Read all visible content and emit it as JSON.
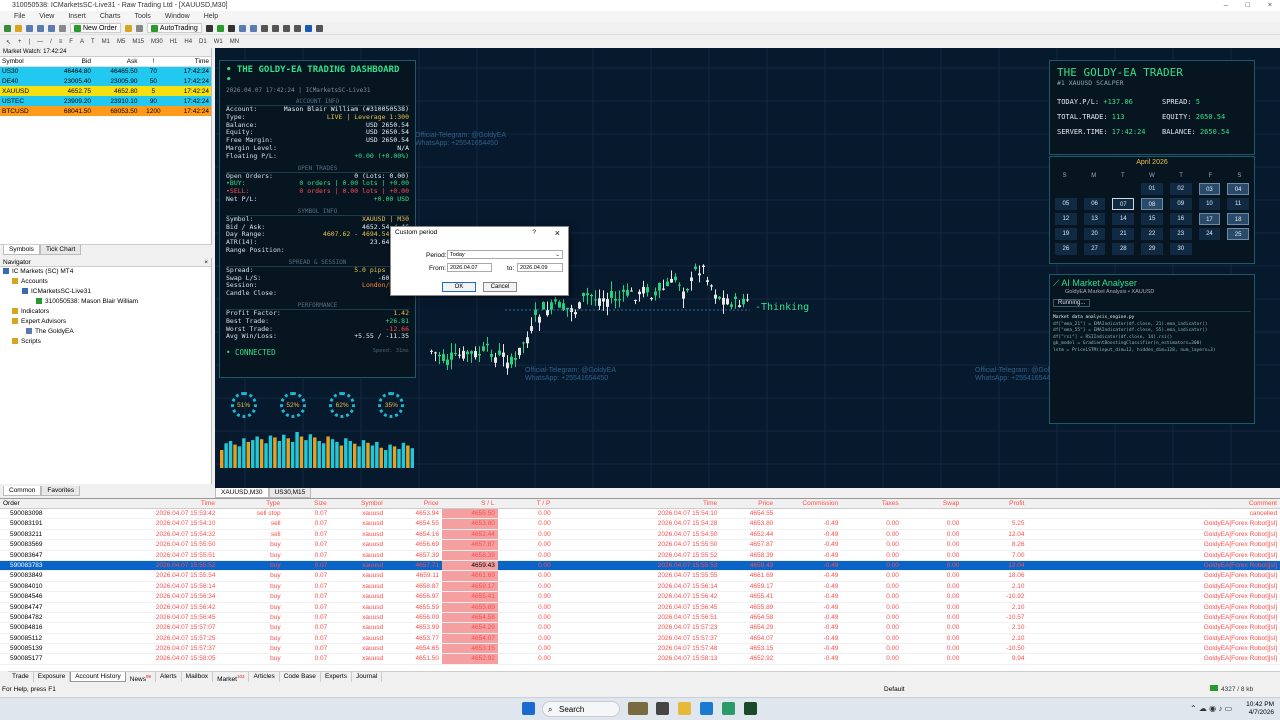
{
  "window": {
    "title": "310050538: ICMarketsSC-Live31 - Raw Trading Ltd - [XAUUSD,M30]",
    "controls": [
      "–",
      "□",
      "×"
    ]
  },
  "menu": [
    "File",
    "View",
    "Insert",
    "Charts",
    "Tools",
    "Window",
    "Help"
  ],
  "toolbar": {
    "new_order": "New Order",
    "autotrading": "AutoTrading"
  },
  "timeframes": [
    "M1",
    "M5",
    "M15",
    "M30",
    "H1",
    "H4",
    "D1",
    "W1",
    "MN"
  ],
  "market_watch": {
    "title": "Market Watch: 17:42:24",
    "columns": [
      "Symbol",
      "Bid",
      "Ask",
      "!",
      "Time"
    ],
    "rows": [
      {
        "symbol": "US30",
        "bid": "46464.80",
        "ask": "46465.50",
        "spread": "70",
        "time": "17:42:24",
        "color": "#21c8f0"
      },
      {
        "symbol": "DE40",
        "bid": "23005.40",
        "ask": "23005.90",
        "spread": "50",
        "time": "17:42:24",
        "color": "#21c8f0"
      },
      {
        "symbol": "XAUUSD",
        "bid": "4652.75",
        "ask": "4652.80",
        "spread": "5",
        "time": "17:42:24",
        "color": "#f7e012"
      },
      {
        "symbol": "USTEC",
        "bid": "23909.20",
        "ask": "23910.10",
        "spread": "90",
        "time": "17:42:24",
        "color": "#21c8f0"
      },
      {
        "symbol": "BTCUSD",
        "bid": "68041.50",
        "ask": "68053.50",
        "spread": "1200",
        "time": "17:42:24",
        "color": "#ff9a1a"
      }
    ],
    "tabs": [
      "Symbols",
      "Tick Chart"
    ]
  },
  "navigator": {
    "title": "Navigator",
    "items": [
      "IC Markets (SC) MT4",
      "Accounts",
      "ICMarketsSC-Live31",
      "310050538: Mason Blair William",
      "Indicators",
      "Expert Advisors",
      "The GoldyEA",
      "Scripts"
    ],
    "tabs": [
      "Common",
      "Favorites"
    ]
  },
  "dashboard": {
    "title": "• THE GOLDY-EA TRADING DASHBOARD •",
    "subtitle": "2026.04.07 17:42:24  |  ICMarketsSC-Live31",
    "sec_account": "ACCOUNT INFO",
    "account": [
      [
        "Account:",
        "Mason Blair William (#310050538)"
      ],
      [
        "Type:",
        "LIVE  |  Leverage 1:300"
      ],
      [
        "Balance:",
        "USD 2650.54"
      ],
      [
        "Equity:",
        "USD 2650.54"
      ],
      [
        "Free Margin:",
        "USD 2650.54"
      ],
      [
        "Margin Level:",
        "N/A"
      ],
      [
        "Floating P/L:",
        "+0.00 (+0.00%)"
      ]
    ],
    "sec_trades": "OPEN TRADES",
    "trades": [
      [
        "Open Orders:",
        "0  (Lots: 0.00)"
      ],
      [
        "•BUY:",
        "0 orders | 0.00 lots | +0.00"
      ],
      [
        "•SELL:",
        "0 orders | 0.00 lots | +0.00"
      ],
      [
        "Net P/L:",
        "+0.00 USD"
      ]
    ],
    "sec_symbol": "SYMBOL INFO",
    "symbol": [
      [
        "Symbol:",
        "XAUUSD  |  M30"
      ],
      [
        "Bid / Ask:",
        "4652.54 / 46"
      ],
      [
        "Day Range:",
        "4607.62 - 4694.54 (869"
      ],
      [
        "ATR(14):",
        "23.64 (236"
      ],
      [
        "Range Position:",
        ""
      ]
    ],
    "sec_spread": "SPREAD & SESSION",
    "spread": [
      [
        "Spread:",
        "5.0 pips (5 po"
      ],
      [
        "Swap L/S:",
        "-60.66 /"
      ],
      [
        "Session:",
        "London/NY Ov"
      ],
      [
        "Candle Close:",
        "17:36"
      ]
    ],
    "sec_perf": "PERFORMANCE",
    "perf": [
      [
        "Profit Factor:",
        "1.42"
      ],
      [
        "Best Trade:",
        "+26.81"
      ],
      [
        "Worst Trade:",
        "-12.66"
      ],
      [
        "Avg Win/Loss:",
        "+5.55 / -11.35"
      ]
    ],
    "status": "• CONNECTED",
    "speed": "Speed: 31ms"
  },
  "gauges": [
    "51%",
    "52%",
    "62%",
    "35%"
  ],
  "volume_bars": [
    40,
    55,
    60,
    52,
    48,
    66,
    58,
    62,
    70,
    64,
    55,
    72,
    68,
    60,
    74,
    66,
    58,
    80,
    70,
    62,
    75,
    68,
    60,
    55,
    70,
    64,
    58,
    50,
    66,
    60,
    54,
    48,
    62,
    56,
    50,
    58,
    45,
    40,
    52,
    48,
    42,
    56,
    50,
    44
  ],
  "trader": {
    "title": "THE GOLDY-EA TRADER",
    "subtitle": "#1 XAUUSD SCALPER",
    "today_label": "TODAY.P/L:",
    "today_value": "+137.06",
    "spread_label": "SPREAD:",
    "spread_value": "5",
    "total_label": "TOTAL.TRADE:",
    "total_value": "113",
    "equity_label": "EQUITY:",
    "equity_value": "2650.54",
    "server_label": "SERVER.TIME:",
    "server_value": "17:42:24",
    "balance_label": "BALANCE:",
    "balance_value": "2650.54"
  },
  "calendar": {
    "month": "April 2026",
    "dow": [
      "S",
      "M",
      "T",
      "W",
      "T",
      "F",
      "S"
    ],
    "days": [
      "",
      "",
      "",
      "01",
      "02",
      "03",
      "04",
      "05",
      "06",
      "07",
      "08",
      "09",
      "10",
      "11",
      "12",
      "13",
      "14",
      "15",
      "16",
      "17",
      "18",
      "19",
      "20",
      "21",
      "22",
      "23",
      "24",
      "25",
      "26",
      "27",
      "28",
      "29",
      "30",
      "",
      ""
    ],
    "highlight": [
      "03",
      "04",
      "08",
      "17",
      "18",
      "25"
    ],
    "today": "07"
  },
  "ai": {
    "title": "AI Market Analyser",
    "subtitle": "GoldyEA Market Analysis • XAUUSD",
    "running": "Running...",
    "code": [
      "Market data analysis_engine.py",
      "df[\"ema_21\"] = EMAIndicator(df.close, 21).ema_indicator()",
      "df[\"ema_55\"] = EMAIndicator(df.close, 55).ema_indicator()",
      "df[\"rsi\"] = RSIIndicator(df.close, 14).rsi()",
      "gb_model = GradientBoostingClassifier(n_estimators=300)",
      "lstm = PriceLSTM(input_dim=12, hidden_dim=128, num_layers=3)"
    ]
  },
  "chart": {
    "watermark_tg": "Official-Telegram: @GoldyEA",
    "watermark_wa": "WhatsApp: +25541654450",
    "thinking": "-Thinking",
    "tabs": [
      "XAUUSD,M30",
      "US30,M15"
    ]
  },
  "dialog": {
    "title": "Custom period",
    "help": "?",
    "close": "×",
    "period_label": "Period:",
    "period_value": "Today",
    "from_label": "From:",
    "from_value": "2026.04.07",
    "to_label": "to:",
    "to_value": "2026.04.09",
    "ok": "OK",
    "cancel": "Cancel"
  },
  "terminal": {
    "columns": [
      "Order",
      "Time",
      "Type",
      "Size",
      "Symbol",
      "Price",
      "S / L",
      "T / P",
      "Time",
      "Price",
      "Commission",
      "Taxes",
      "Swap",
      "Profit",
      "Comment"
    ],
    "rows": [
      [
        "590083098",
        "2026.04.07 15:53:42",
        "sell stop",
        "0.07",
        "xauusd",
        "4653.94",
        "4655.50",
        "0.00",
        "2026.04.07 15:54:10",
        "4654.55",
        "",
        "",
        "",
        "",
        "cancelled"
      ],
      [
        "590083191",
        "2026.04.07 15:54:10",
        "sell",
        "0.07",
        "xauusd",
        "4654.55",
        "4653.80",
        "0.00",
        "2026.04.07 15:54:28",
        "4653.80",
        "-0.49",
        "0.00",
        "0.00",
        "5.25",
        "GoldyEA[Forex Robot][sl]"
      ],
      [
        "590083211",
        "2026.04.07 15:54:32",
        "sell",
        "0.07",
        "xauusd",
        "4654.16",
        "4652.44",
        "0.00",
        "2026.04.07 15:54:50",
        "4652.44",
        "-0.49",
        "0.00",
        "0.00",
        "12.04",
        "GoldyEA[Forex Robot][sl]"
      ],
      [
        "590083569",
        "2026.04.07 15:55:50",
        "buy",
        "0.07",
        "xauusd",
        "4656.69",
        "4657.87",
        "0.00",
        "2026.04.07 15:55:50",
        "4657.87",
        "-0.49",
        "0.00",
        "0.00",
        "8.26",
        "GoldyEA[Forex Robot][sl]"
      ],
      [
        "590083647",
        "2026.04.07 15:55:51",
        "buy",
        "0.07",
        "xauusd",
        "4657.39",
        "4658.39",
        "0.00",
        "2026.04.07 15:55:52",
        "4658.39",
        "-0.49",
        "0.00",
        "0.00",
        "7.00",
        "GoldyEA[Forex Robot][sl]"
      ],
      [
        "590083783",
        "2026.04.07 15:55:52",
        "buy",
        "0.07",
        "xauusd",
        "4657.71",
        "4659.43",
        "0.00",
        "2026.04.07 15:55:53",
        "4659.43",
        "-0.49",
        "0.00",
        "0.00",
        "12.04",
        "GoldyEA[Forex Robot][sl]"
      ],
      [
        "590083849",
        "2026.04.07 15:55:54",
        "buy",
        "0.07",
        "xauusd",
        "4659.11",
        "4661.69",
        "0.00",
        "2026.04.07 15:55:55",
        "4661.69",
        "-0.49",
        "0.00",
        "0.00",
        "18.06",
        "GoldyEA[Forex Robot][sl]"
      ],
      [
        "590084010",
        "2026.04.07 15:56:14",
        "buy",
        "0.07",
        "xauusd",
        "4658.87",
        "4659.17",
        "0.00",
        "2026.04.07 15:56:14",
        "4659.17",
        "-0.49",
        "0.00",
        "0.00",
        "2.10",
        "GoldyEA[Forex Robot][sl]"
      ],
      [
        "590084546",
        "2026.04.07 15:56:34",
        "buy",
        "0.07",
        "xauusd",
        "4656.97",
        "4655.41",
        "0.00",
        "2026.04.07 15:56:42",
        "4655.41",
        "-0.49",
        "0.00",
        "0.00",
        "-10.92",
        "GoldyEA[Forex Robot][sl]"
      ],
      [
        "590084747",
        "2026.04.07 15:56:42",
        "buy",
        "0.07",
        "xauusd",
        "4655.59",
        "4655.89",
        "0.00",
        "2026.04.07 15:56:45",
        "4655.89",
        "-0.49",
        "0.00",
        "0.00",
        "2.10",
        "GoldyEA[Forex Robot][sl]"
      ],
      [
        "590084782",
        "2026.04.07 15:56:45",
        "buy",
        "0.07",
        "xauusd",
        "4656.09",
        "4654.58",
        "0.00",
        "2026.04.07 15:56:51",
        "4654.58",
        "-0.49",
        "0.00",
        "0.00",
        "-10.57",
        "GoldyEA[Forex Robot][sl]"
      ],
      [
        "590084816",
        "2026.04.07 15:57:07",
        "buy",
        "0.07",
        "xauusd",
        "4653.99",
        "4654.29",
        "0.00",
        "2026.04.07 15:57:23",
        "4654.29",
        "-0.49",
        "0.00",
        "0.00",
        "2.10",
        "GoldyEA[Forex Robot][sl]"
      ],
      [
        "590085112",
        "2026.04.07 15:57:25",
        "buy",
        "0.07",
        "xauusd",
        "4653.77",
        "4654.07",
        "0.00",
        "2026.04.07 15:57:37",
        "4654.07",
        "-0.49",
        "0.00",
        "0.00",
        "2.10",
        "GoldyEA[Forex Robot][sl]"
      ],
      [
        "590085139",
        "2026.04.07 15:57:37",
        "buy",
        "0.07",
        "xauusd",
        "4654.65",
        "4653.15",
        "0.00",
        "2026.04.07 15:57:48",
        "4653.15",
        "-0.49",
        "0.00",
        "0.00",
        "-10.50",
        "GoldyEA[Forex Robot][sl]"
      ],
      [
        "590085177",
        "2026.04.07 15:58:05",
        "buy",
        "0.07",
        "xauusd",
        "4651.50",
        "4652.92",
        "0.00",
        "2026.04.07 15:58:13",
        "4652.92",
        "-0.49",
        "0.00",
        "0.00",
        "9.94",
        "GoldyEA[Forex Robot][sl]"
      ]
    ],
    "selected_index": 5,
    "tabs": [
      "Trade",
      "Exposure",
      "Account History",
      "News",
      "Alerts",
      "Mailbox",
      "Market",
      "Articles",
      "Code Base",
      "Experts",
      "Journal"
    ],
    "active_tab": "Account History",
    "news_badge": "99",
    "market_badge": "103"
  },
  "status": {
    "help": "For Help, press F1",
    "profile": "Default",
    "traffic": "4327 / 8 kb"
  },
  "taskbar": {
    "search": "Search",
    "time": "10:42 PM",
    "date": "4/7/2026"
  }
}
